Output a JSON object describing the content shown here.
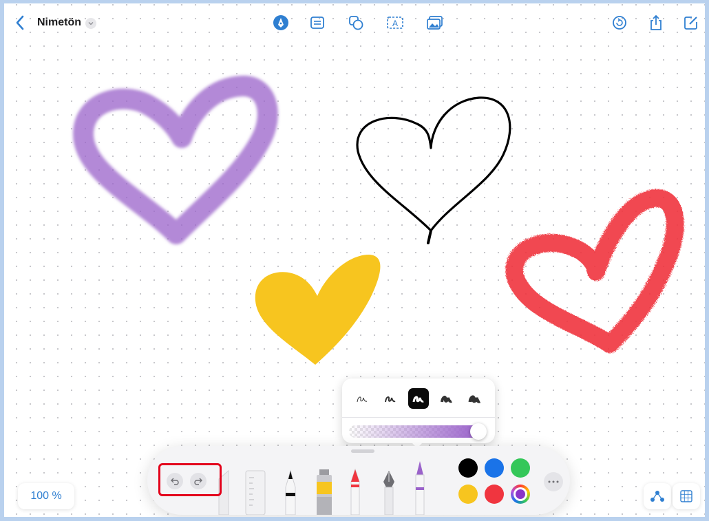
{
  "document": {
    "title": "Nimetön"
  },
  "zoom": {
    "label": "100 %"
  },
  "colors": {
    "accent": "#2f7fd1",
    "heart_purple": "#9a62ca",
    "heart_black": "#000000",
    "heart_yellow": "#f7c51f",
    "heart_red": "#f0353f",
    "highlight": "#e3001b"
  },
  "topbar": {
    "left": [
      "back-chevron-icon",
      "title-dropdown-icon"
    ],
    "center_tools": [
      "markup-pen-icon",
      "note-icon",
      "shapes-icon",
      "text-box-icon",
      "media-icon"
    ],
    "right": [
      "history-icon",
      "share-icon",
      "new-board-icon"
    ]
  },
  "pen_options": {
    "stroke_widths": [
      "thin",
      "light",
      "medium",
      "bold",
      "heavy"
    ],
    "selected_stroke": "medium",
    "opacity": 1.0
  },
  "tool_palette": {
    "tools": [
      "ruler",
      "pen",
      "paint-tube",
      "marker",
      "fountain-pen",
      "watercolor-brush"
    ],
    "selected_tool": "watercolor-brush",
    "swatches": [
      "#000000",
      "#1a73e8",
      "#34c759",
      "#f7c51f",
      "#f0353f",
      "multicolor"
    ],
    "selected_swatch": "multicolor"
  },
  "corner_buttons": [
    "connector-icon",
    "grid-icon"
  ]
}
